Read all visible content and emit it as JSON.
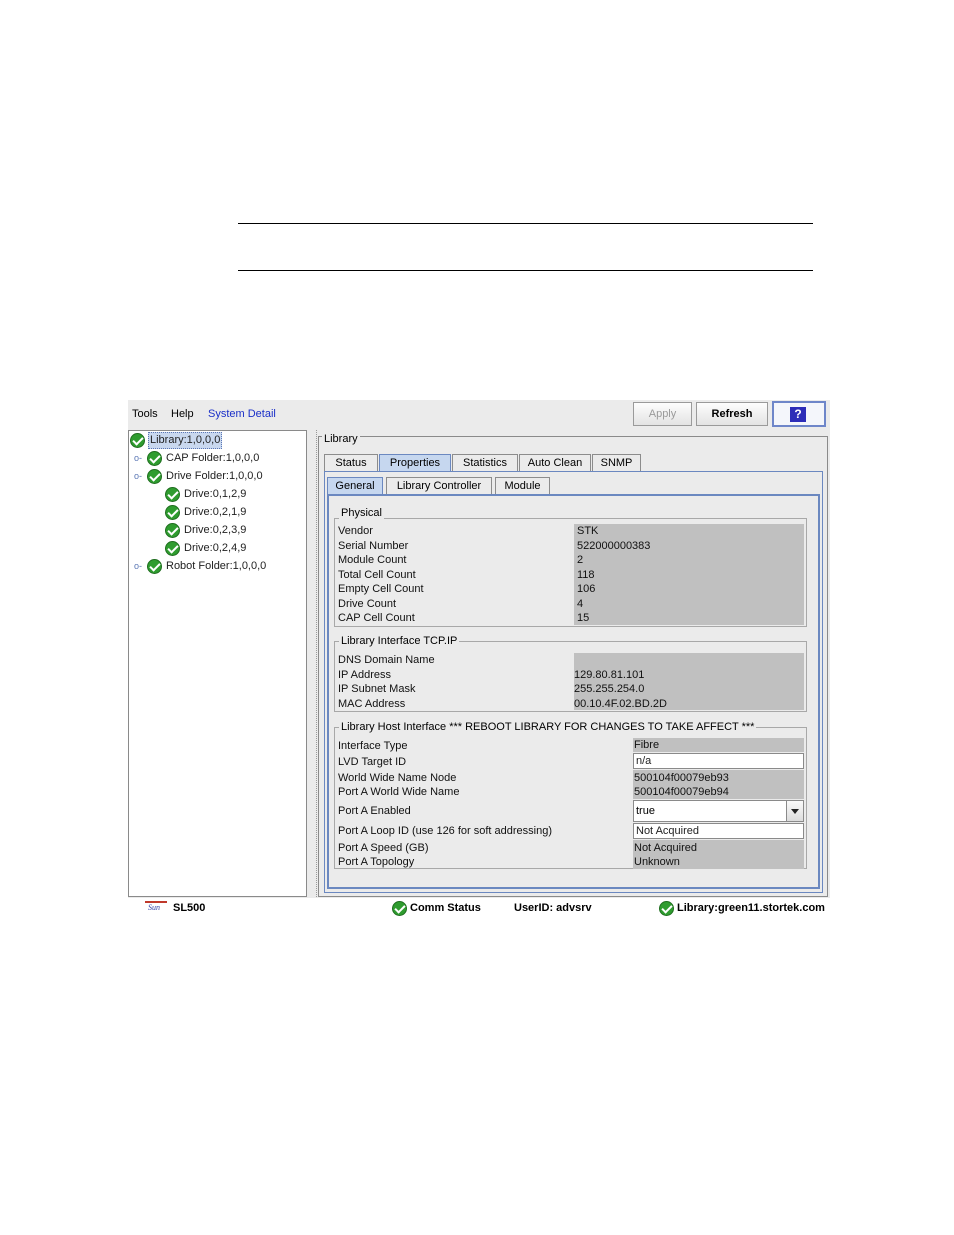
{
  "menu": {
    "tools": "Tools",
    "help": "Help",
    "system_detail": "System Detail"
  },
  "toolbar": {
    "apply": "Apply",
    "refresh": "Refresh",
    "help_icon": "?"
  },
  "tree": {
    "root": "Library:1,0,0,0",
    "cap_folder": "CAP Folder:1,0,0,0",
    "drive_folder": "Drive Folder:1,0,0,0",
    "drives": [
      "Drive:0,1,2,9",
      "Drive:0,2,1,9",
      "Drive:0,2,3,9",
      "Drive:0,2,4,9"
    ],
    "robot_folder": "Robot Folder:1,0,0,0"
  },
  "library_box": {
    "legend": "Library"
  },
  "tabs": [
    "Status",
    "Properties",
    "Statistics",
    "Auto Clean",
    "SNMP"
  ],
  "subtabs": [
    "General",
    "Library Controller",
    "Module"
  ],
  "physical": {
    "legend": "Physical",
    "rows": [
      {
        "label": "Vendor",
        "value": "STK"
      },
      {
        "label": "Serial Number",
        "value": "522000000383"
      },
      {
        "label": "Module Count",
        "value": "2"
      },
      {
        "label": "Total Cell Count",
        "value": "118"
      },
      {
        "label": "Empty Cell Count",
        "value": "106"
      },
      {
        "label": "Drive Count",
        "value": "4"
      },
      {
        "label": "CAP Cell Count",
        "value": "15"
      }
    ]
  },
  "tcpip": {
    "legend": "Library Interface TCP.IP",
    "rows": [
      {
        "label": "DNS Domain Name",
        "value": ""
      },
      {
        "label": "IP Address",
        "value": "129.80.81.101"
      },
      {
        "label": "IP Subnet Mask",
        "value": "255.255.254.0"
      },
      {
        "label": "MAC Address",
        "value": "00.10.4F.02.BD.2D"
      }
    ]
  },
  "host": {
    "legend": "Library Host Interface *** REBOOT LIBRARY FOR CHANGES TO TAKE AFFECT ***",
    "interface_type_label": "Interface Type",
    "interface_type_value": "Fibre",
    "lvd_label": "LVD Target ID",
    "lvd_value": "n/a",
    "wwn_node_label": "World Wide Name Node",
    "wwn_node_value": "500104f00079eb93",
    "porta_wwn_label": "Port A World Wide Name",
    "porta_wwn_value": "500104f00079eb94",
    "porta_enabled_label": "Port A Enabled",
    "porta_enabled_value": "true",
    "loop_id_label": "Port A Loop ID (use 126 for soft addressing)",
    "loop_id_value": "Not Acquired",
    "speed_label": "Port A Speed (GB)",
    "speed_value": "Not Acquired",
    "topology_label": "Port A Topology",
    "topology_value": "Unknown"
  },
  "statusbar": {
    "logo_text": "Sun",
    "model": "SL500",
    "comm_status": "Comm Status",
    "user": "UserID: advsrv",
    "library_host": "Library:green11.stortek.com"
  }
}
